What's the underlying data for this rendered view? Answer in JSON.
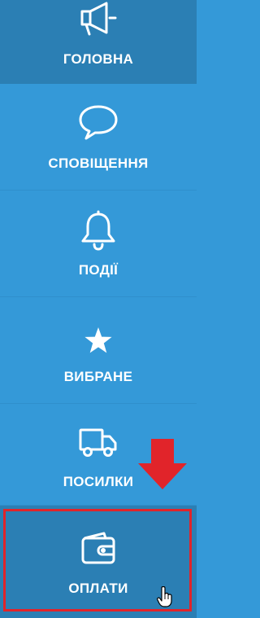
{
  "colors": {
    "sidebar_bg": "#3499d8",
    "active_bg": "#2b7fb4",
    "text": "#ffffff",
    "annotation_red": "#e1242a"
  },
  "nav": {
    "items": [
      {
        "label": "ГОЛОВНА",
        "icon": "megaphone-icon",
        "active": true
      },
      {
        "label": "СПОВІЩЕННЯ",
        "icon": "speech-bubble-icon",
        "active": false
      },
      {
        "label": "ПОДІЇ",
        "icon": "bell-icon",
        "active": false
      },
      {
        "label": "ВИБРАНЕ",
        "icon": "star-icon",
        "active": false
      },
      {
        "label": "ПОСИЛКИ",
        "icon": "truck-icon",
        "active": false
      },
      {
        "label": "ОПЛАТИ",
        "icon": "wallet-icon",
        "active": true
      }
    ]
  },
  "annotation": {
    "arrow": "down-arrow-icon",
    "cursor": "hand-pointer-icon"
  }
}
